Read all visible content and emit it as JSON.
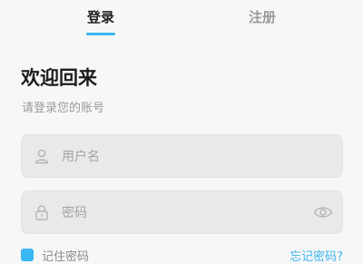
{
  "tabs": {
    "login_label": "登录",
    "register_label": "注册"
  },
  "header": {
    "title": "欢迎回来",
    "subtitle": "请登录您的账号"
  },
  "form": {
    "username": {
      "placeholder": "用户名",
      "value": "",
      "icon": "user-icon"
    },
    "password": {
      "placeholder": "密码",
      "value": "",
      "icon": "lock-icon",
      "toggle_icon": "eye-icon"
    }
  },
  "options": {
    "remember_label": "记住密码",
    "forgot_label": "忘记密码?"
  },
  "colors": {
    "accent": "#3ab6f0",
    "background": "#f7f7f7",
    "field_bg": "#e9e9e9"
  }
}
